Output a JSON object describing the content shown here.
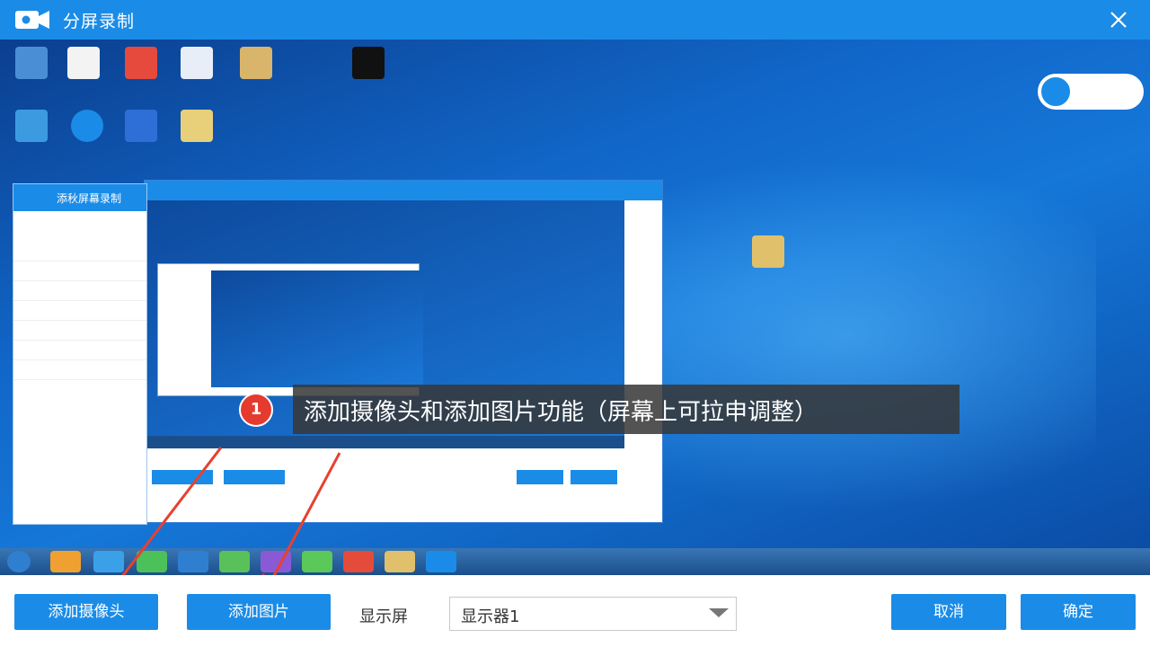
{
  "window": {
    "title": "分屏录制"
  },
  "callout": {
    "number": "1",
    "text": "添加摄像头和添加图片功能（屏幕上可拉申调整）"
  },
  "toolbar": {
    "add_camera_label": "添加摄像头",
    "add_image_label": "添加图片",
    "display_label": "显示屏",
    "display_value": "显示器1",
    "cancel_label": "取消",
    "confirm_label": "确定"
  },
  "embedded_screen": {
    "inner_window_title": "添秋屏幕录制"
  },
  "colors": {
    "accent": "#1a8ce8",
    "callout_bg": "#373737",
    "badge": "#e53b2f",
    "arrow": "#e8402f"
  },
  "icons": [
    "video-camera-icon",
    "close-icon",
    "chevron-down-icon"
  ]
}
